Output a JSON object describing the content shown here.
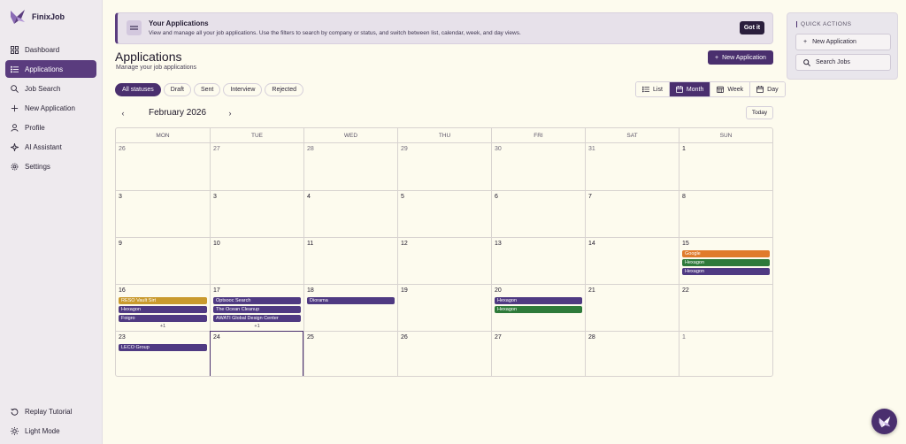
{
  "brand": {
    "name": "FinixJob"
  },
  "sidebar": {
    "items": [
      {
        "label": "Dashboard",
        "icon": "dashboard-icon"
      },
      {
        "label": "Applications",
        "icon": "list-icon",
        "active": true
      },
      {
        "label": "Job Search",
        "icon": "search-icon"
      },
      {
        "label": "New Application",
        "icon": "plus-icon"
      },
      {
        "label": "Profile",
        "icon": "user-icon"
      },
      {
        "label": "AI Assistant",
        "icon": "sparkle-icon"
      },
      {
        "label": "Settings",
        "icon": "gear-icon"
      }
    ],
    "bottom": [
      {
        "label": "Replay Tutorial",
        "icon": "replay-icon"
      },
      {
        "label": "Light Mode",
        "icon": "sun-icon"
      }
    ]
  },
  "banner": {
    "title": "Your Applications",
    "text": "View and manage all your job applications. Use the filters to search by company or status, and switch between list, calendar, week, and day views.",
    "button": "Got it"
  },
  "header": {
    "title": "Applications",
    "subtitle": "Manage your job applications",
    "new_button": "New Application"
  },
  "filters": [
    {
      "label": "All statuses",
      "active": true
    },
    {
      "label": "Draft"
    },
    {
      "label": "Sent"
    },
    {
      "label": "Interview"
    },
    {
      "label": "Rejected"
    }
  ],
  "views": [
    {
      "label": "List",
      "icon": "list-icon"
    },
    {
      "label": "Month",
      "icon": "calendar-icon",
      "active": true
    },
    {
      "label": "Week",
      "icon": "week-icon"
    },
    {
      "label": "Day",
      "icon": "day-icon"
    }
  ],
  "calendar": {
    "month_label": "February 2026",
    "prev": "‹",
    "next": "›",
    "today_button": "Today",
    "weekdays": [
      "MON",
      "TUE",
      "WED",
      "THU",
      "FRI",
      "SAT",
      "SUN"
    ],
    "weeks": [
      [
        {
          "day": "26",
          "dim": true
        },
        {
          "day": "27",
          "dim": true
        },
        {
          "day": "28",
          "dim": true
        },
        {
          "day": "29",
          "dim": true
        },
        {
          "day": "30",
          "dim": true
        },
        {
          "day": "31",
          "dim": true
        },
        {
          "day": "1"
        }
      ],
      [
        {
          "day": "3"
        },
        {
          "day": "3"
        },
        {
          "day": "4"
        },
        {
          "day": "5"
        },
        {
          "day": "6"
        },
        {
          "day": "7"
        },
        {
          "day": "8"
        }
      ],
      [
        {
          "day": "9"
        },
        {
          "day": "10"
        },
        {
          "day": "11"
        },
        {
          "day": "12"
        },
        {
          "day": "13"
        },
        {
          "day": "14"
        },
        {
          "day": "15",
          "events": [
            {
              "title": "Google",
              "color": "#e07b2c"
            },
            {
              "title": "Hexagon",
              "color": "#2e7a3a"
            },
            {
              "title": "Hexagon",
              "color": "#4f3a82"
            }
          ]
        }
      ],
      [
        {
          "day": "16",
          "events": [
            {
              "title": "RESO Vault Sirt",
              "color": "#c99a2e"
            },
            {
              "title": "Hexagon",
              "color": "#4f3a82"
            },
            {
              "title": "Foigro",
              "color": "#4f3a82"
            }
          ],
          "more": "+1"
        },
        {
          "day": "17",
          "events": [
            {
              "title": "Optsooc Search",
              "color": "#4f3a82"
            },
            {
              "title": "The Ocean Cleanup",
              "color": "#4f3a82"
            },
            {
              "title": "AWATI Global Design Center",
              "color": "#4f3a82"
            }
          ],
          "more": "+1"
        },
        {
          "day": "18",
          "events": [
            {
              "title": "Diorama",
              "color": "#4f3a82"
            }
          ]
        },
        {
          "day": "19"
        },
        {
          "day": "20",
          "events": [
            {
              "title": "Hexagon",
              "color": "#4f3a82"
            },
            {
              "title": "Hexagon",
              "color": "#2e7a3a"
            }
          ]
        },
        {
          "day": "21"
        },
        {
          "day": "22"
        }
      ],
      [
        {
          "day": "23",
          "events": [
            {
              "title": "LECO Group",
              "color": "#4f3a82"
            }
          ]
        },
        {
          "day": "24",
          "selected": true
        },
        {
          "day": "25"
        },
        {
          "day": "26"
        },
        {
          "day": "27"
        },
        {
          "day": "28"
        },
        {
          "day": "1",
          "dim": true
        }
      ]
    ]
  },
  "quick_actions": {
    "title": "QUICK ACTIONS",
    "items": [
      {
        "label": "New Application",
        "icon": "plus-icon"
      },
      {
        "label": "Search Jobs",
        "icon": "search-icon"
      }
    ]
  },
  "colors": {
    "accent": "#4a2f6e",
    "background": "#fdfbee"
  }
}
